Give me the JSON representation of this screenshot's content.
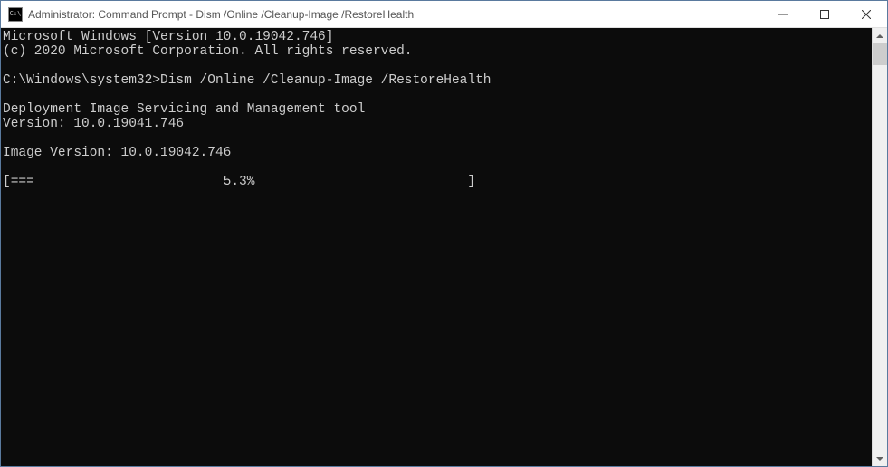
{
  "titlebar": {
    "icon_label": "C:\\",
    "title": "Administrator: Command Prompt - Dism  /Online /Cleanup-Image /RestoreHealth"
  },
  "console": {
    "line1": "Microsoft Windows [Version 10.0.19042.746]",
    "line2": "(c) 2020 Microsoft Corporation. All rights reserved.",
    "blank1": "",
    "prompt": "C:\\Windows\\system32>Dism /Online /Cleanup-Image /RestoreHealth",
    "blank2": "",
    "tool1": "Deployment Image Servicing and Management tool",
    "tool2": "Version: 10.0.19041.746",
    "blank3": "",
    "imgver": "Image Version: 10.0.19042.746",
    "blank4": "",
    "progress": "[===                        5.3%                           ]"
  }
}
